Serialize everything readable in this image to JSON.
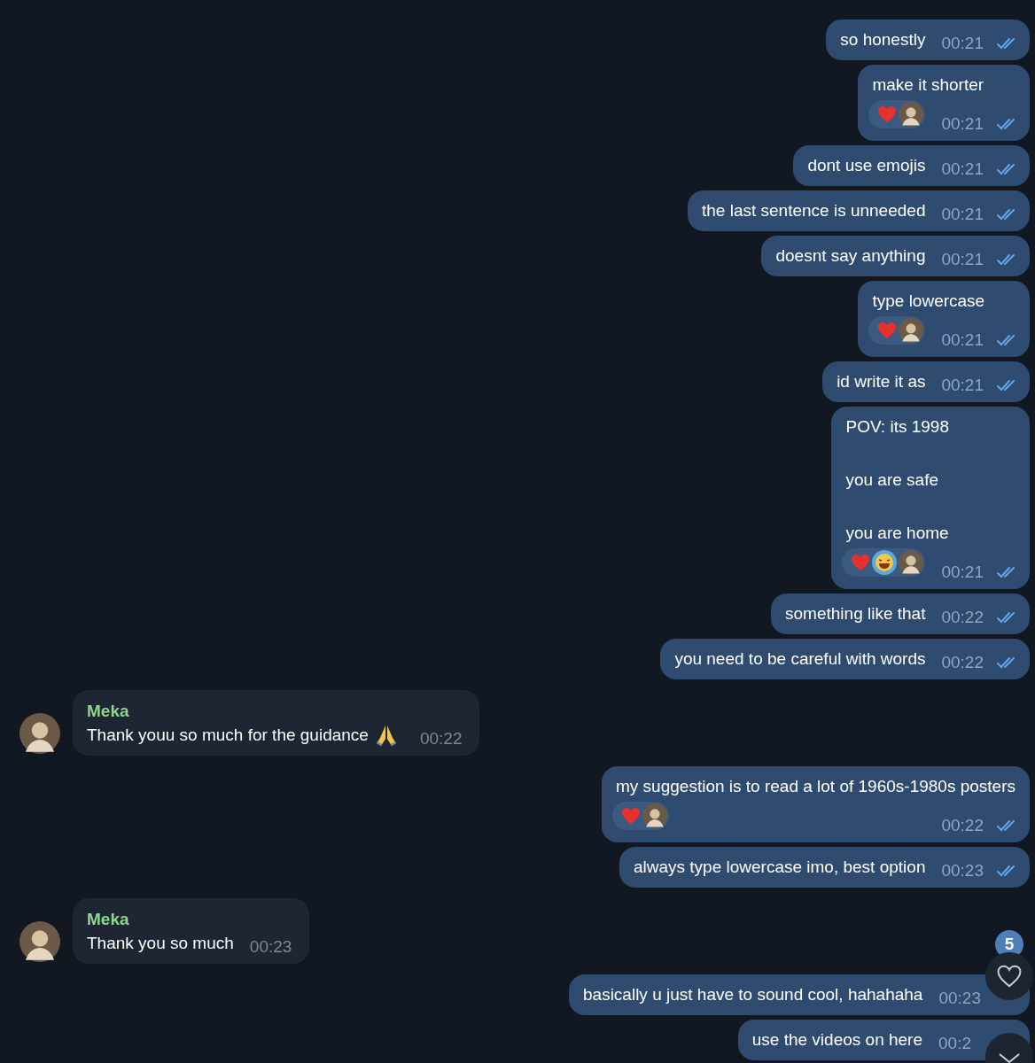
{
  "messages": [
    {
      "kind": "outgoing",
      "text": "so honestly",
      "time": "00:21",
      "read": true
    },
    {
      "kind": "outgoing",
      "text": "make it shorter",
      "reactions": [
        {
          "kind": "heart"
        },
        {
          "kind": "avatar"
        }
      ],
      "time": "00:21",
      "read": true
    },
    {
      "kind": "outgoing",
      "text": "dont use emojis",
      "time": "00:21",
      "read": true
    },
    {
      "kind": "outgoing",
      "text": "the last sentence is unneeded",
      "time": "00:21",
      "read": true
    },
    {
      "kind": "outgoing",
      "text": "doesnt say anything",
      "time": "00:21",
      "read": true
    },
    {
      "kind": "outgoing",
      "text": "type lowercase",
      "reactions": [
        {
          "kind": "heart"
        },
        {
          "kind": "avatar"
        }
      ],
      "time": "00:21",
      "read": true
    },
    {
      "kind": "outgoing",
      "text": "id write it as",
      "time": "00:21",
      "read": true
    },
    {
      "kind": "outgoing",
      "text": "POV: its 1998\n\nyou are safe\n\nyou are home",
      "reactions": [
        {
          "kind": "heart"
        },
        {
          "kind": "laugh"
        },
        {
          "kind": "avatar"
        }
      ],
      "time": "00:21",
      "read": true
    },
    {
      "kind": "outgoing",
      "text": "something like that",
      "time": "00:22",
      "read": true
    },
    {
      "kind": "outgoing",
      "text": "you need to be careful with words",
      "time": "00:22",
      "read": true
    },
    {
      "kind": "incoming",
      "sender": "Meka",
      "text": "Thank youu so much for the guidance",
      "emoji": {
        "kind": "pray"
      },
      "time": "00:22"
    },
    {
      "kind": "outgoing",
      "text": "my suggestion is to read a lot of 1960s-1980s posters",
      "reactions": [
        {
          "kind": "heart"
        },
        {
          "kind": "avatar"
        }
      ],
      "time": "00:22",
      "read": true
    },
    {
      "kind": "outgoing",
      "text": "always type lowercase imo, best option",
      "time": "00:23",
      "read": true
    },
    {
      "kind": "incoming",
      "sender": "Meka",
      "text": "Thank you so much",
      "time": "00:23"
    },
    {
      "kind": "outgoing",
      "text": "basically u just have to sound cool, hahahaha",
      "time": "00:23"
    },
    {
      "kind": "outgoing",
      "text": "use the videos on here",
      "time": "00:2"
    }
  ],
  "unread_badge": "5"
}
